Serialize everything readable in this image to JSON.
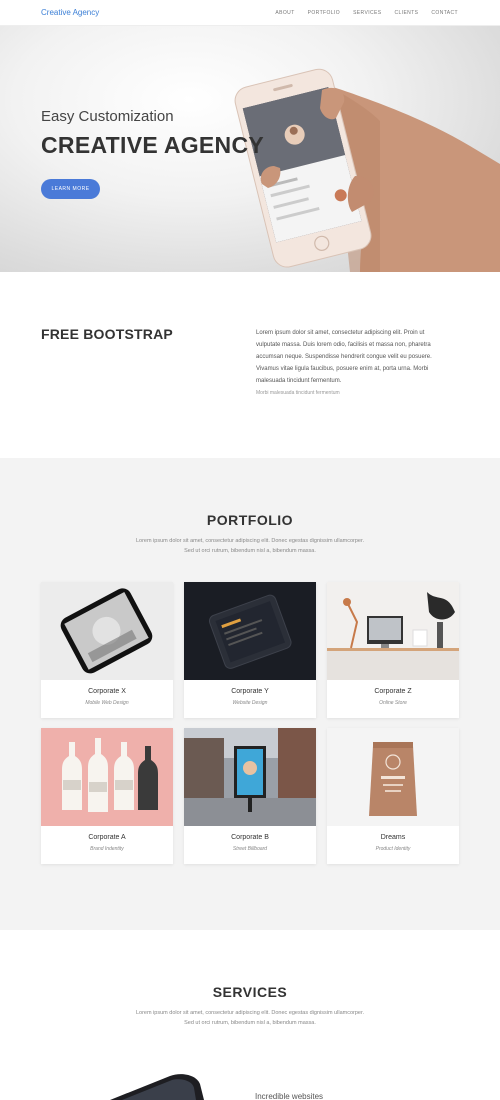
{
  "nav": {
    "brand": "Creative Agency",
    "items": [
      "ABOUT",
      "PORTFOLIO",
      "SERVICES",
      "CLIENTS",
      "CONTACT"
    ]
  },
  "hero": {
    "subtitle": "Easy Customization",
    "title": "CREATIVE AGENCY",
    "button": "LEARN MORE"
  },
  "about": {
    "title": "FREE BOOTSTRAP",
    "lines": [
      "Lorem ipsum dolor sit amet, consectetur adipiscing elit. Proin ut",
      "vulputate massa. Duis lorem odio, facilisis et massa non, pharetra",
      "accumsan neque. Suspendisse hendrerit congue velit eu posuere.",
      "Vivamus vitae ligula faucibus, posuere enim at, porta urna. Morbi",
      "malesuada tincidunt fermentum."
    ],
    "muted": "Morbi malesuada tincidunt fermentum"
  },
  "portfolio": {
    "title": "PORTFOLIO",
    "desc_line1": "Lorem ipsum dolor sit amet, consectetur adipiscing elit. Donec egestas dignissim ullamcorper.",
    "desc_line2": "Sed ut orci rutrum, bibendum nisl a, bibendum massa.",
    "cards": [
      {
        "title": "Corporate X",
        "subtitle": "Mobile Web Design"
      },
      {
        "title": "Corporate Y",
        "subtitle": "Website Design"
      },
      {
        "title": "Corporate Z",
        "subtitle": "Online Store"
      },
      {
        "title": "Corporate A",
        "subtitle": "Brand Indentity"
      },
      {
        "title": "Corporate B",
        "subtitle": "Street Billboard"
      },
      {
        "title": "Dreams",
        "subtitle": "Product Identity"
      }
    ]
  },
  "services": {
    "title": "SERVICES",
    "desc_line1": "Lorem ipsum dolor sit amet, consectetur adipiscing elit. Donec egestas dignissim ullamcorper.",
    "desc_line2": "Sed ut orci rutrum, bibendum nisl a, bibendum massa.",
    "feature_title": "Incredible websites"
  },
  "colors": {
    "accent": "#4a7ad8",
    "brand": "#3b7fd6",
    "section_gray": "#f3f3f3"
  }
}
